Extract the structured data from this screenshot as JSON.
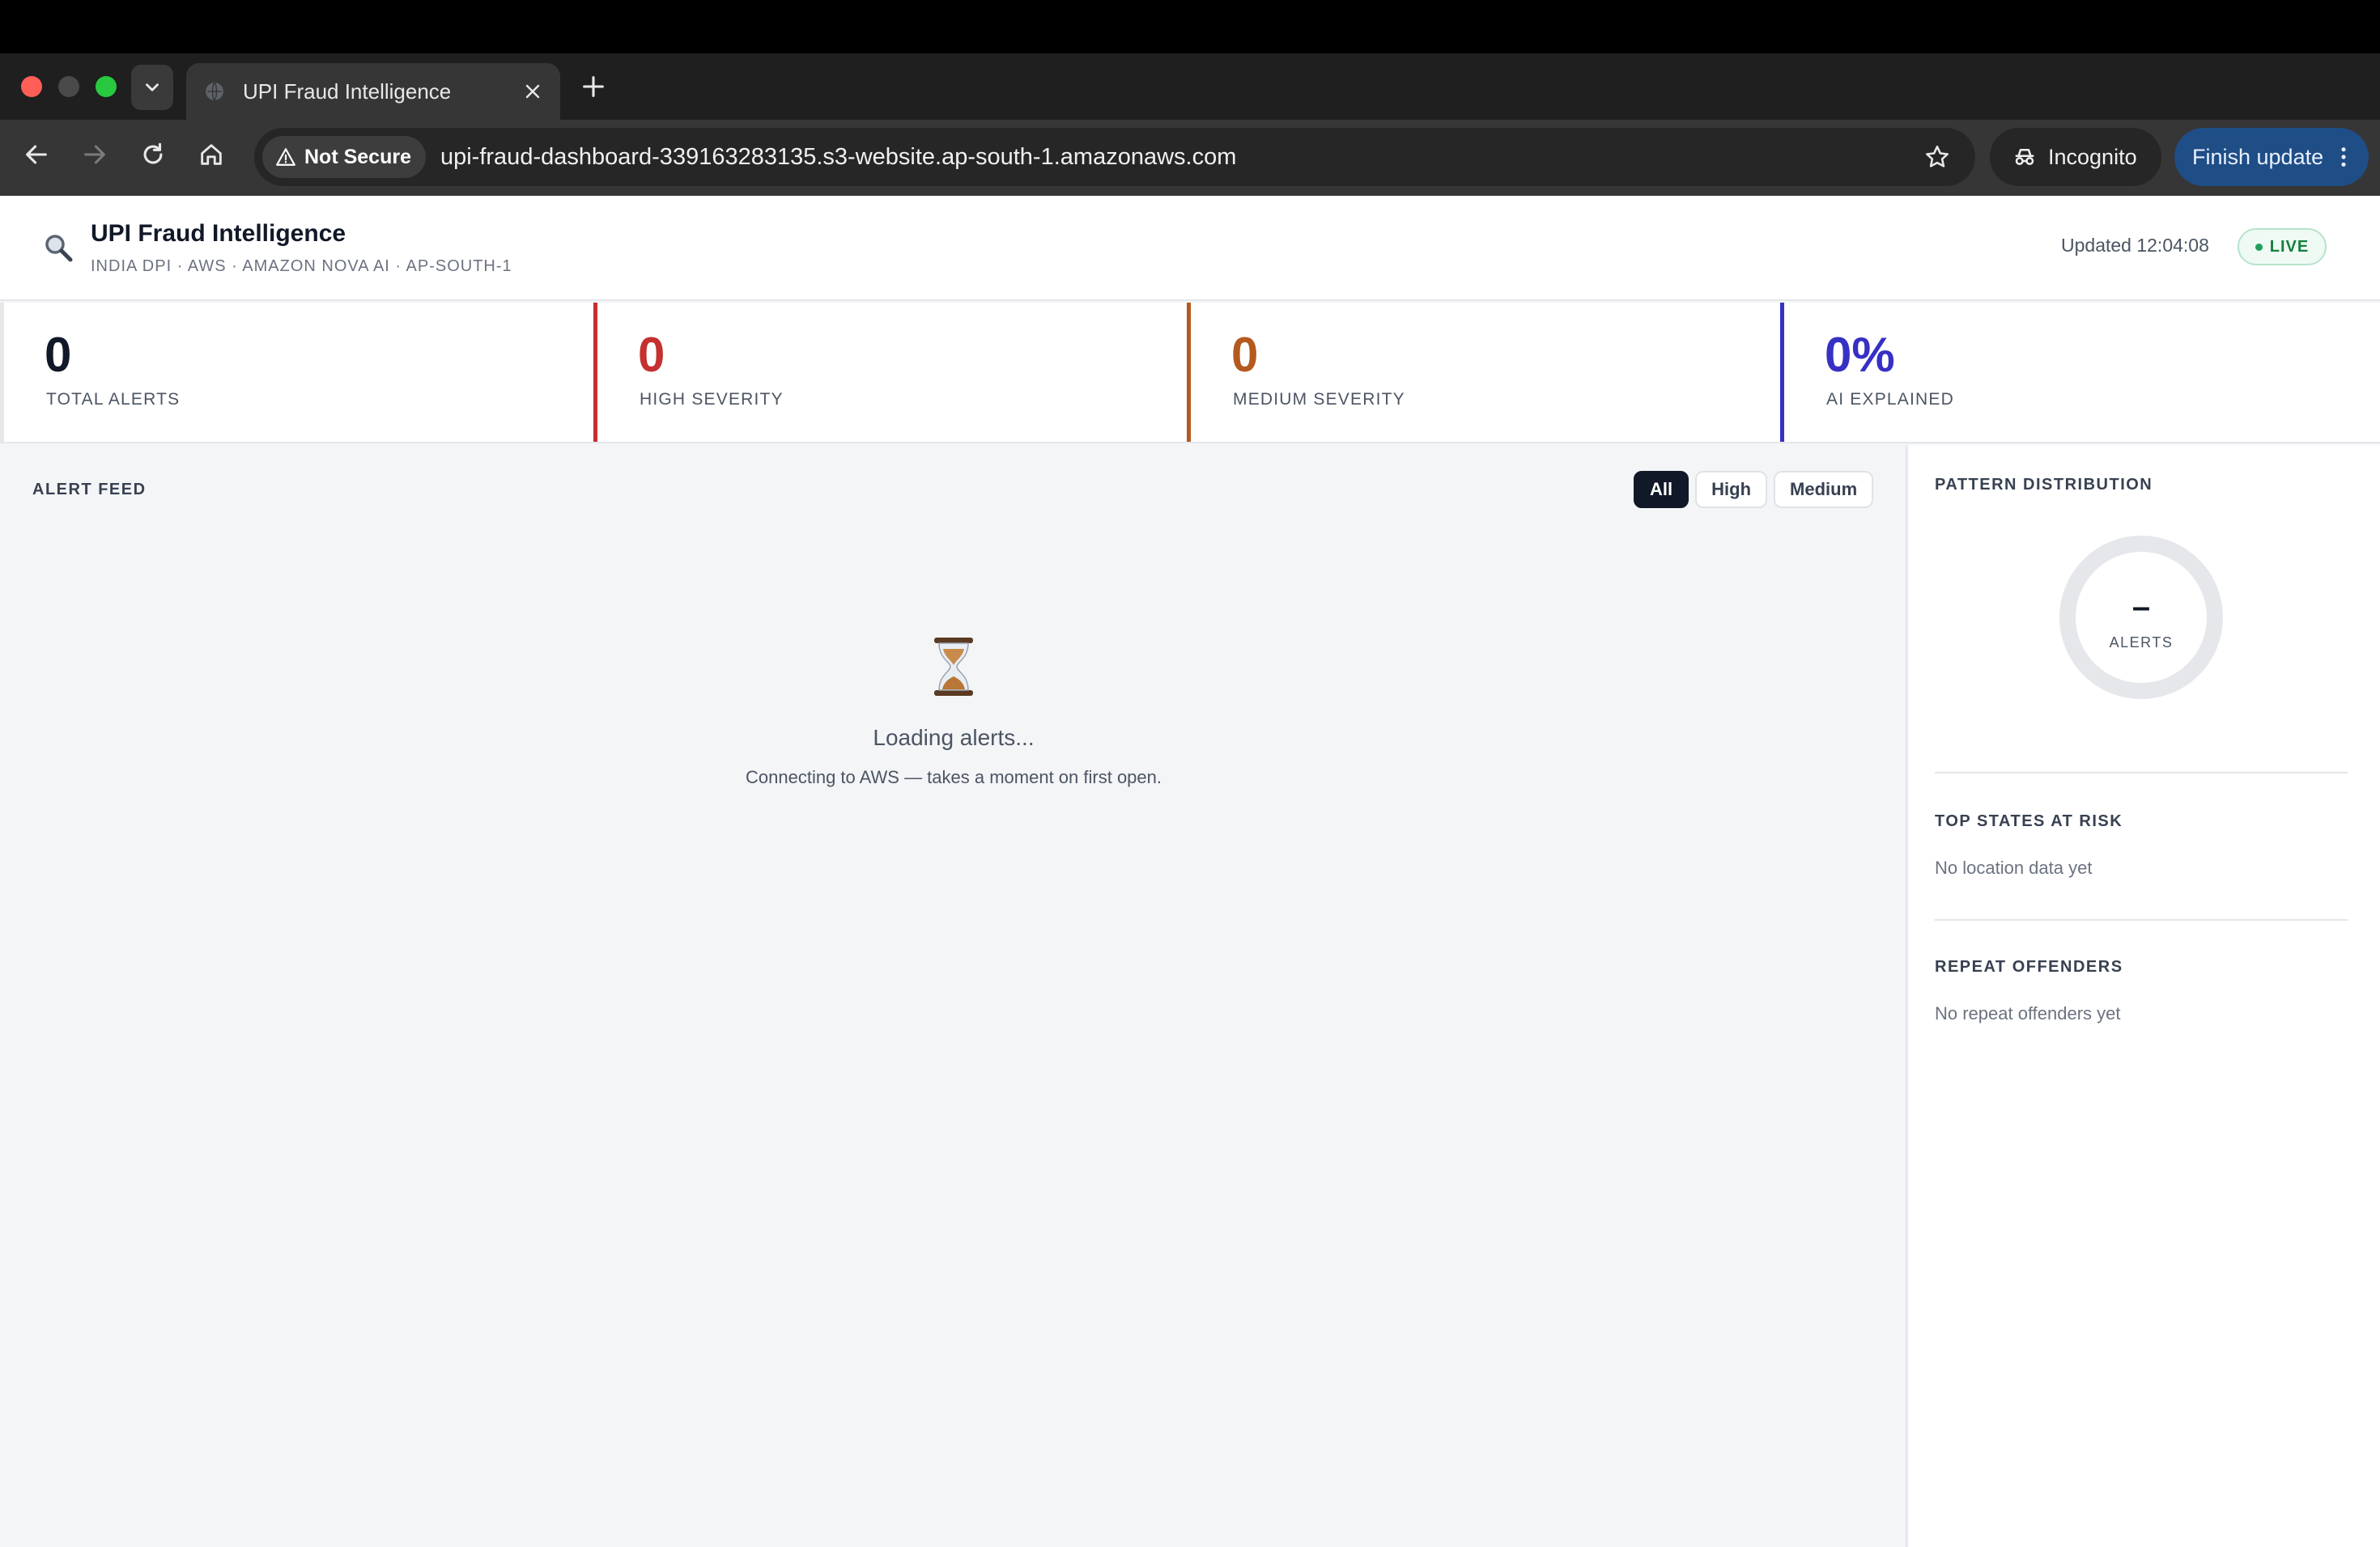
{
  "browser": {
    "tab_title": "UPI Fraud Intelligence",
    "security_label": "Not Secure",
    "url": "upi-fraud-dashboard-339163283135.s3-website.ap-south-1.amazonaws.com",
    "incognito_label": "Incognito",
    "update_label": "Finish update"
  },
  "header": {
    "title": "UPI Fraud Intelligence",
    "subtitle": "INDIA DPI · AWS · AMAZON NOVA AI · AP-SOUTH-1",
    "updated": "Updated 12:04:08",
    "live_label": "LIVE"
  },
  "stats": [
    {
      "value": "0",
      "label": "TOTAL ALERTS",
      "color": "#111827",
      "accent": "#e5e7eb"
    },
    {
      "value": "0",
      "label": "HIGH SEVERITY",
      "color": "#c53030",
      "accent": "#c53030"
    },
    {
      "value": "0",
      "label": "MEDIUM SEVERITY",
      "color": "#b45a1f",
      "accent": "#b45a1f"
    },
    {
      "value": "0%",
      "label": "AI EXPLAINED",
      "color": "#3730c4",
      "accent": "#3730c4"
    }
  ],
  "feed": {
    "title": "ALERT FEED",
    "filters": [
      "All",
      "High",
      "Medium"
    ],
    "active_filter": "All",
    "loading_icon": "hourglass-icon",
    "loading_title": "Loading alerts...",
    "loading_subtitle": "Connecting to AWS — takes a moment on first open."
  },
  "sidebar": {
    "pattern_title": "PATTERN DISTRIBUTION",
    "donut_value": "–",
    "donut_label": "ALERTS",
    "states_title": "TOP STATES AT RISK",
    "states_empty": "No location data yet",
    "offenders_title": "REPEAT OFFENDERS",
    "offenders_empty": "No repeat offenders yet"
  }
}
